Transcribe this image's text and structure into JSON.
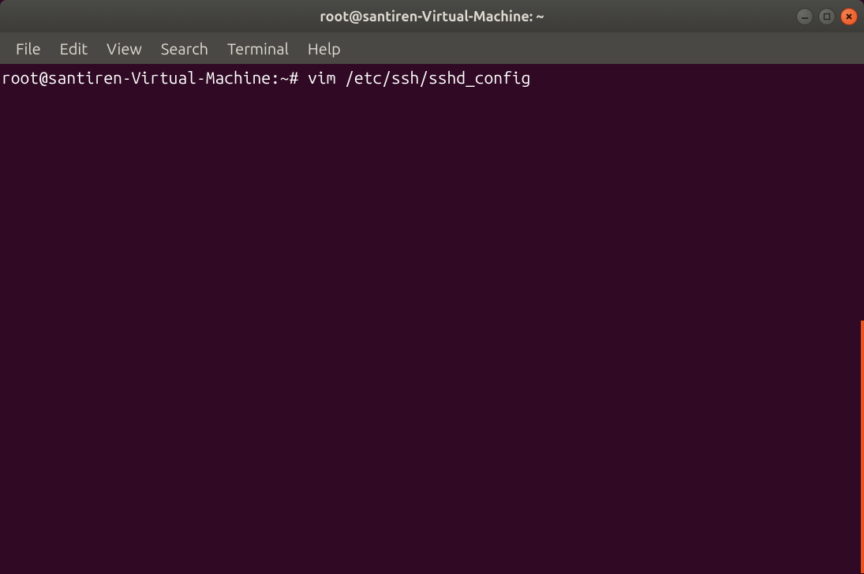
{
  "titlebar": {
    "title": "root@santiren-Virtual-Machine: ~"
  },
  "menubar": {
    "items": [
      "File",
      "Edit",
      "View",
      "Search",
      "Terminal",
      "Help"
    ]
  },
  "terminal": {
    "prompt": "root@santiren-Virtual-Machine:~#",
    "command": "vim /etc/ssh/sshd_config"
  },
  "colors": {
    "background": "#300a24",
    "accent": "#e95420",
    "text": "#ffffff",
    "chrome": "#494844"
  }
}
